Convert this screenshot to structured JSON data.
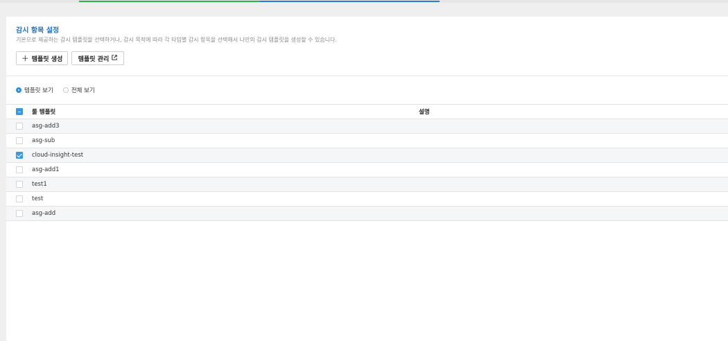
{
  "section": {
    "title": "감시 항목 설정",
    "description": "기본으로 제공하는 감시 템플릿을 선택하거나, 감시 목적에 따라 각 타입별 감시 항목을 선택해서 나만의 감시 템플릿을 생성할 수 있습니다."
  },
  "buttons": {
    "create_label": "템플릿 생성",
    "manage_label": "템플릿 관리"
  },
  "view_options": {
    "template_view": "템플릿 보기",
    "all_view": "전체 보기",
    "selected": "template_view"
  },
  "table": {
    "headers": {
      "name": "룰 템플릿",
      "description": "설명"
    },
    "rows": [
      {
        "name": "asg-add3",
        "description": "",
        "checked": false
      },
      {
        "name": "asg-sub",
        "description": "",
        "checked": false
      },
      {
        "name": "cloud-insight-test",
        "description": "",
        "checked": true
      },
      {
        "name": "asg-add1",
        "description": "",
        "checked": false
      },
      {
        "name": "test1",
        "description": "",
        "checked": false
      },
      {
        "name": "test",
        "description": "",
        "checked": false
      },
      {
        "name": "asg-add",
        "description": "",
        "checked": false
      }
    ]
  },
  "colors": {
    "accent": "#1a73c8",
    "progress_green": "#2fb44c",
    "progress_blue": "#2b7cd3",
    "checkbox_checked": "#3b98e0"
  },
  "icons": {
    "create": "plus-icon",
    "manage": "external-link-icon"
  }
}
